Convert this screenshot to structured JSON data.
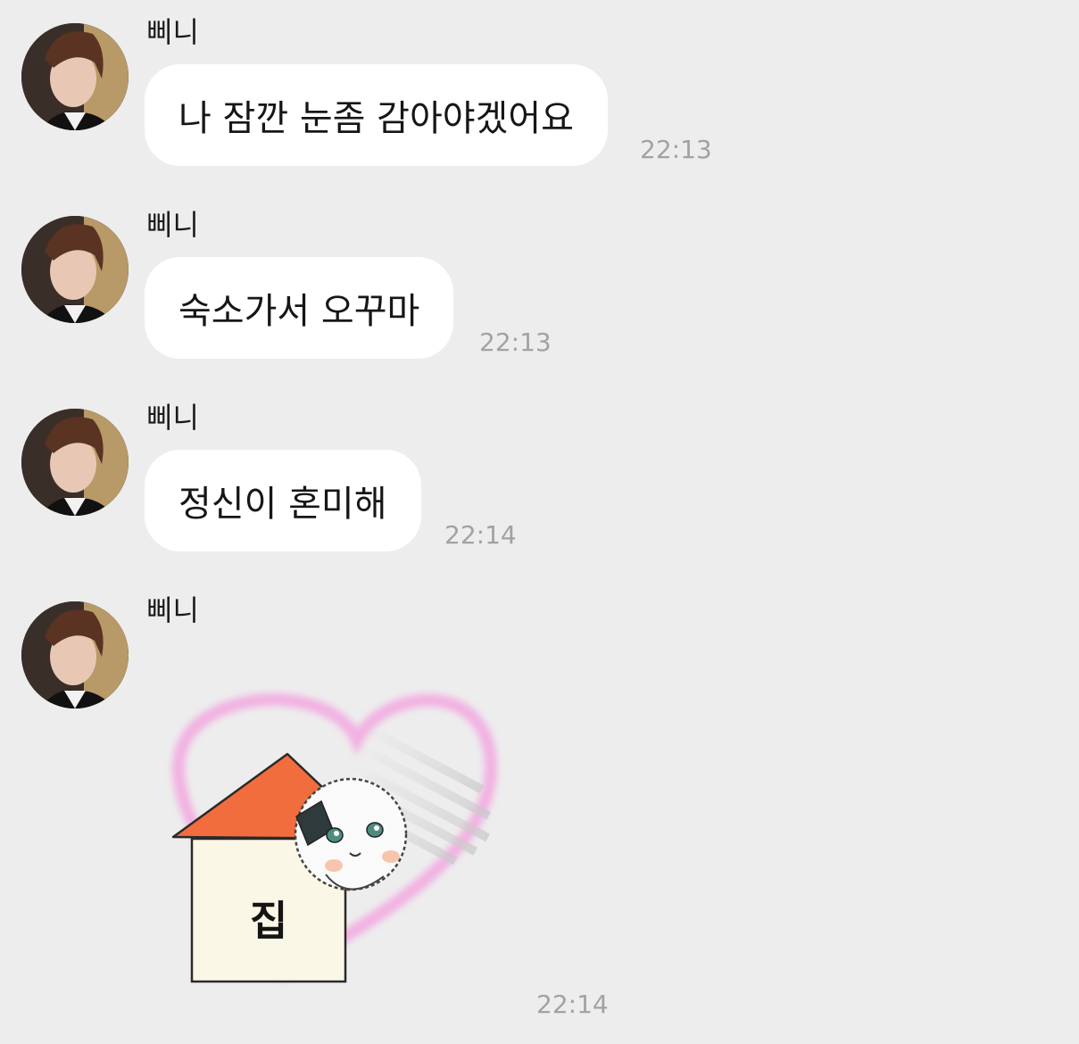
{
  "messages": [
    {
      "sender": "삐니",
      "text": "나 잠깐 눈좀 감아야겠어요",
      "time": "22:13"
    },
    {
      "sender": "삐니",
      "text": "숙소가서 오꾸마",
      "time": "22:13"
    },
    {
      "sender": "삐니",
      "text": "정신이 혼미해",
      "time": "22:14"
    }
  ],
  "sticker_message": {
    "sender": "삐니",
    "sticker_text": "집",
    "time": "22:14"
  },
  "colors": {
    "background": "#ededed",
    "bubble": "#ffffff",
    "time": "#a2a2a2",
    "heart": "#f3a6e0",
    "roof": "#f26d3d"
  }
}
